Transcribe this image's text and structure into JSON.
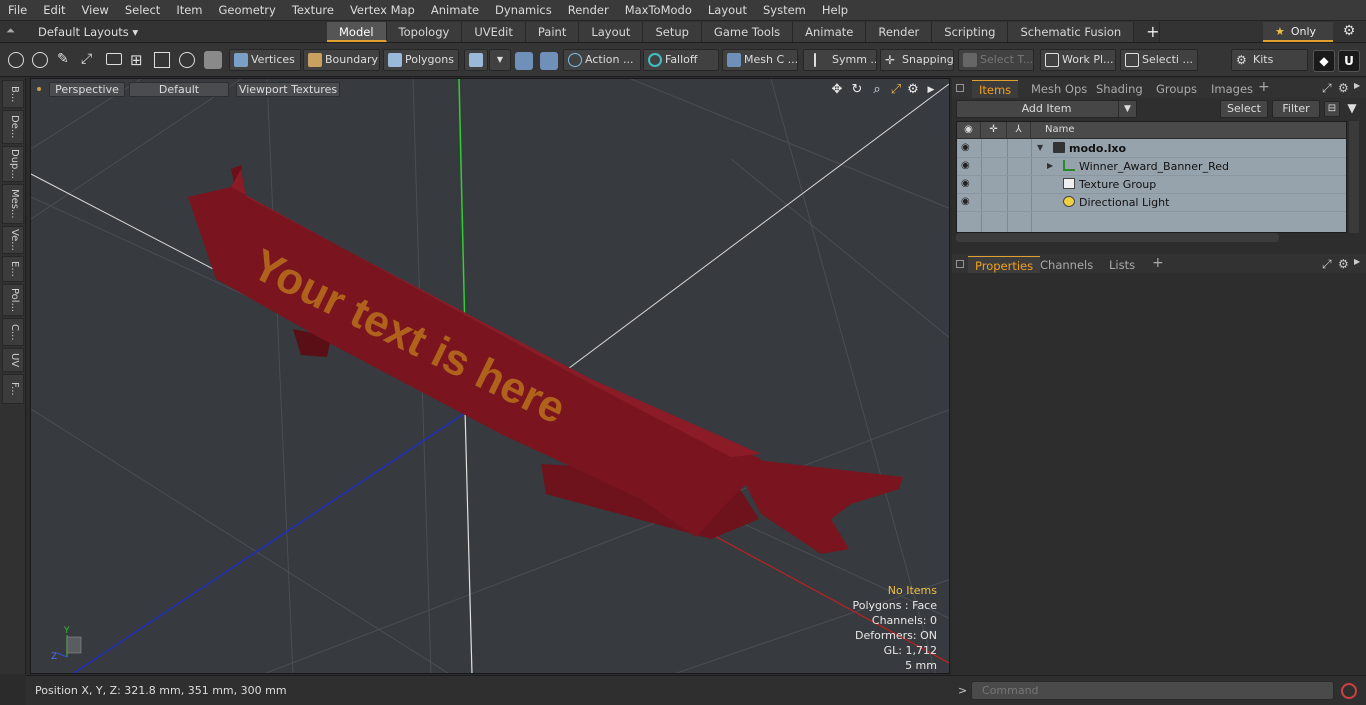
{
  "menu": [
    "File",
    "Edit",
    "View",
    "Select",
    "Item",
    "Geometry",
    "Texture",
    "Vertex Map",
    "Animate",
    "Dynamics",
    "Render",
    "MaxToModo",
    "Layout",
    "System",
    "Help"
  ],
  "layout_selector": "Default Layouts ▾",
  "layout_tabs": [
    "Model",
    "Topology",
    "UVEdit",
    "Paint",
    "Layout",
    "Setup",
    "Game Tools",
    "Animate",
    "Render",
    "Scripting",
    "Schematic Fusion"
  ],
  "active_layout_tab": "Model",
  "only_label": "Only",
  "toolbar": {
    "vertices": "Vertices",
    "boundary": "Boundary",
    "polygons": "Polygons",
    "action": "Action ...",
    "falloff": "Falloff",
    "mesh_c": "Mesh C ...",
    "symm": "Symm ...",
    "snapping": "Snapping",
    "select_t": "Select T...",
    "work_pl": "Work Pl...",
    "selecti": "Selecti ...",
    "kits": "Kits"
  },
  "left_strip": [
    "B...",
    "De...",
    "Dup...",
    "Mes...",
    "Ve...",
    "E...",
    "Pol...",
    "C...",
    "UV",
    "F..."
  ],
  "viewport": {
    "view": "Perspective",
    "shading": "Default",
    "textures": "Viewport Textures",
    "banner_text": "Your text is here",
    "stats": {
      "no_items": "No Items",
      "polygons": "Polygons : Face",
      "channels": "Channels: 0",
      "deformers": "Deformers: ON",
      "gl": "GL: 1,712",
      "scale": "5 mm"
    },
    "axis_labels": {
      "y": "Y",
      "z": "Z"
    }
  },
  "status": {
    "position": "Position X, Y, Z:  321.8 mm, 351 mm, 300 mm"
  },
  "items_panel": {
    "tabs": [
      "Items",
      "Mesh Ops",
      "Shading",
      "Groups",
      "Images"
    ],
    "active_tab": "Items",
    "add_item": "Add Item",
    "select": "Select",
    "filter": "Filter",
    "name_col": "Name",
    "tree": [
      {
        "name": "modo.lxo",
        "level": 0
      },
      {
        "name": "Winner_Award_Banner_Red",
        "level": 1
      },
      {
        "name": "Texture Group",
        "level": 1
      },
      {
        "name": "Directional Light",
        "level": 1
      }
    ]
  },
  "properties_panel": {
    "tabs": [
      "Properties",
      "Channels",
      "Lists"
    ],
    "active_tab": "Properties"
  },
  "command": {
    "prompt": ">",
    "placeholder": "Command"
  },
  "colors": {
    "accent": "#e0a030",
    "banner_red": "#7a1520",
    "banner_text": "#b0621c",
    "viewport_bg": "#373a3e",
    "tree_bg": "#97a3ac"
  }
}
